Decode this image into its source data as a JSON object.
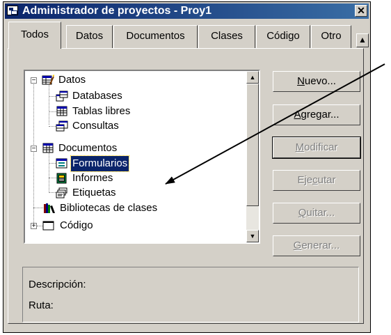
{
  "window": {
    "title": "Administrador de proyectos - Proy1",
    "close_label": "✕"
  },
  "tabs": [
    {
      "label": "Todos",
      "active": true
    },
    {
      "label": "Datos"
    },
    {
      "label": "Documentos"
    },
    {
      "label": "Clases"
    },
    {
      "label": "Código"
    },
    {
      "label": "Otro"
    }
  ],
  "tab_overflow_icon": "arrow-up-icon",
  "tree": {
    "items": [
      {
        "label": "Datos",
        "icon": "database-folder-icon",
        "expander": "−"
      },
      {
        "label": "Databases",
        "icon": "databases-icon"
      },
      {
        "label": "Tablas libres",
        "icon": "free-tables-icon"
      },
      {
        "label": "Consultas",
        "icon": "queries-icon"
      },
      {
        "label": "Documentos",
        "icon": "documents-icon",
        "expander": "−"
      },
      {
        "label": "Formularios",
        "icon": "forms-icon",
        "selected": true
      },
      {
        "label": "Informes",
        "icon": "reports-icon"
      },
      {
        "label": "Etiquetas",
        "icon": "labels-icon"
      },
      {
        "label": "Bibliotecas de clases",
        "icon": "class-library-icon"
      },
      {
        "label": "Código",
        "icon": "code-icon",
        "expander": "+"
      }
    ]
  },
  "buttons": {
    "nuevo": {
      "key": "N",
      "rest": "uevo..."
    },
    "agregar": {
      "key": "A",
      "rest": "gregar..."
    },
    "modificar": {
      "key": "M",
      "rest": "odificar"
    },
    "ejecutar": {
      "pre": "Eje",
      "key": "c",
      "rest": "utar"
    },
    "quitar": {
      "key": "Q",
      "rest": "uitar..."
    },
    "generar": {
      "key": "G",
      "rest": "enerar..."
    }
  },
  "info": {
    "description_label": "Descripción:",
    "path_label": "Ruta:"
  },
  "colors": {
    "title_gradient_start": "#0a246a",
    "title_gradient_end": "#3a6ea5",
    "selection": "#0a246a",
    "face": "#d4d0c8"
  }
}
